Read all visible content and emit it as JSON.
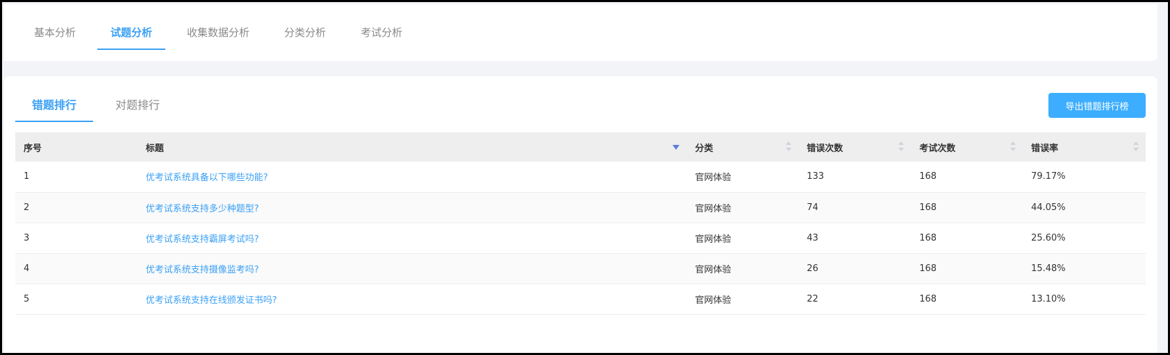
{
  "top_tabs": [
    {
      "label": "基本分析"
    },
    {
      "label": "试题分析"
    },
    {
      "label": "收集数据分析"
    },
    {
      "label": "分类分析"
    },
    {
      "label": "考试分析"
    }
  ],
  "sub_tabs": [
    {
      "label": "错题排行"
    },
    {
      "label": "对题排行"
    }
  ],
  "export_button": {
    "label": "导出错题排行榜"
  },
  "table": {
    "headers": {
      "index": "序号",
      "title": "标题",
      "category": "分类",
      "wrong_count": "错误次数",
      "exam_count": "考试次数",
      "error_rate": "错误率"
    },
    "rows": [
      {
        "index": "1",
        "title": "优考试系统具备以下哪些功能?",
        "category": "官网体验",
        "wrong_count": "133",
        "exam_count": "168",
        "error_rate": "79.17%"
      },
      {
        "index": "2",
        "title": "优考试系统支持多少种题型?",
        "category": "官网体验",
        "wrong_count": "74",
        "exam_count": "168",
        "error_rate": "44.05%"
      },
      {
        "index": "3",
        "title": "优考试系统支持霸屏考试吗?",
        "category": "官网体验",
        "wrong_count": "43",
        "exam_count": "168",
        "error_rate": "25.60%"
      },
      {
        "index": "4",
        "title": "优考试系统支持摄像监考吗?",
        "category": "官网体验",
        "wrong_count": "26",
        "exam_count": "168",
        "error_rate": "15.48%"
      },
      {
        "index": "5",
        "title": "优考试系统支持在线颁发证书吗?",
        "category": "官网体验",
        "wrong_count": "22",
        "exam_count": "168",
        "error_rate": "13.10%"
      }
    ]
  },
  "colors": {
    "accent": "#3aa0f5",
    "button": "#3daeff",
    "sort_active": "#5b7be0"
  }
}
